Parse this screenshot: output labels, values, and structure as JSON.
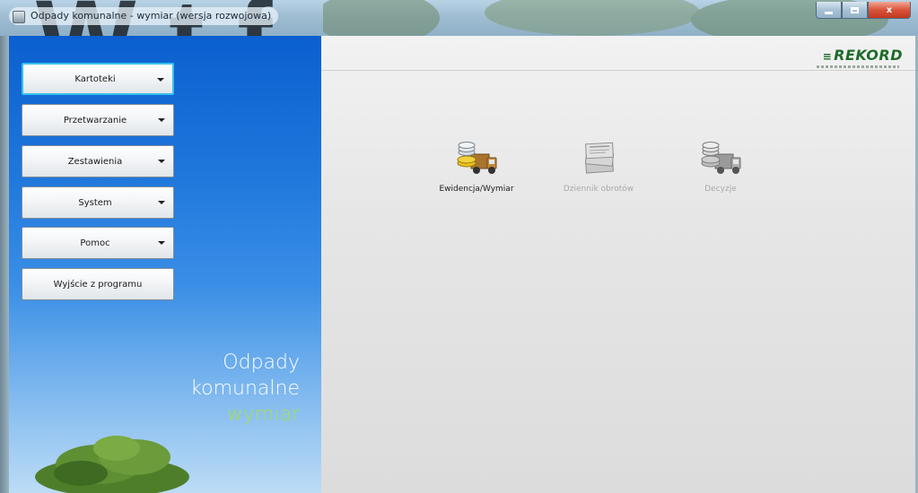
{
  "window": {
    "title": "Odpady komunalne - wymiar (wersja rozwojowa)",
    "background_text": "W                          t     f",
    "controls": {
      "minimize": "minimize",
      "maximize": "maximize",
      "close": "x"
    }
  },
  "sidebar": {
    "buttons": [
      {
        "label": "Kartoteki",
        "has_menu": true,
        "active": true
      },
      {
        "label": "Przetwarzanie",
        "has_menu": true
      },
      {
        "label": "Zestawienia",
        "has_menu": true
      },
      {
        "label": "System",
        "has_menu": true
      },
      {
        "label": "Pomoc",
        "has_menu": true
      },
      {
        "label": "Wyjście z programu",
        "has_menu": false
      }
    ],
    "brand": {
      "line1": "Odpady",
      "line2": "komunalne",
      "line3": "wymiar"
    }
  },
  "main": {
    "logo": {
      "text": "REKORD",
      "icon": "rekord-arrows-logo"
    },
    "tiles": [
      {
        "label": "Ewidencja/Wymiar",
        "icon": "truck-coins-icon",
        "enabled": true
      },
      {
        "label": "Dziennik obrotów",
        "icon": "newspaper-stack-icon",
        "enabled": false
      },
      {
        "label": "Decyzje",
        "icon": "truck-coins-icon",
        "enabled": false
      }
    ]
  },
  "colors": {
    "sidebar_top": "#0b5fcf",
    "sidebar_bottom": "#bcdcf6",
    "brand_accent": "#a4e24a",
    "logo_green": "#1f6b2a",
    "active_border": "#35c0ee"
  }
}
